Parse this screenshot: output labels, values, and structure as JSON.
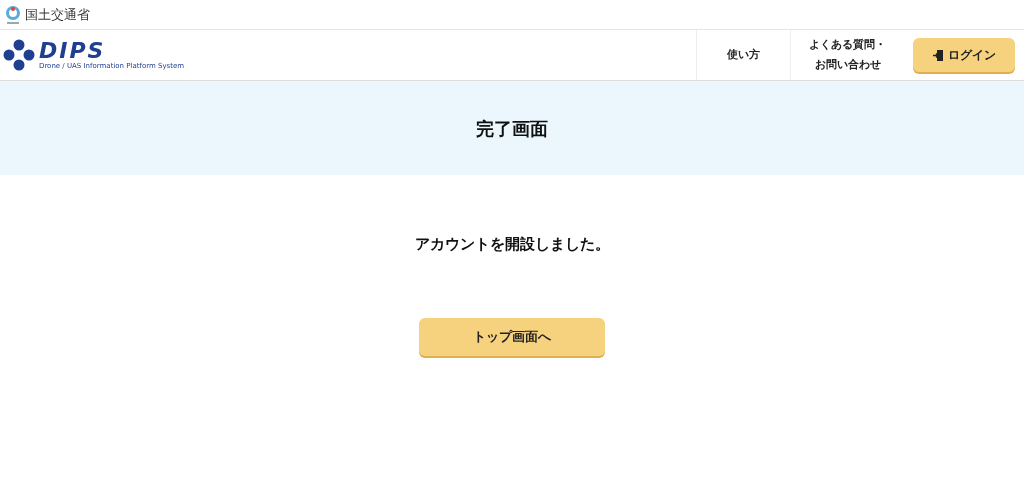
{
  "ministry": {
    "name": "国土交通省"
  },
  "header": {
    "logo": {
      "title": "DIPS",
      "subtitle": "Drone / UAS Information Platform System"
    },
    "nav": [
      {
        "kind": "link",
        "lines": [
          "使い方"
        ]
      },
      {
        "kind": "link",
        "lines": [
          "よくある質問・",
          "お問い合わせ"
        ]
      },
      {
        "kind": "login",
        "lines": [
          "ログイン"
        ]
      }
    ]
  },
  "banner": {
    "title": "完了画面"
  },
  "message": "アカウントを開設しました。",
  "button": "トップ画面へ"
}
